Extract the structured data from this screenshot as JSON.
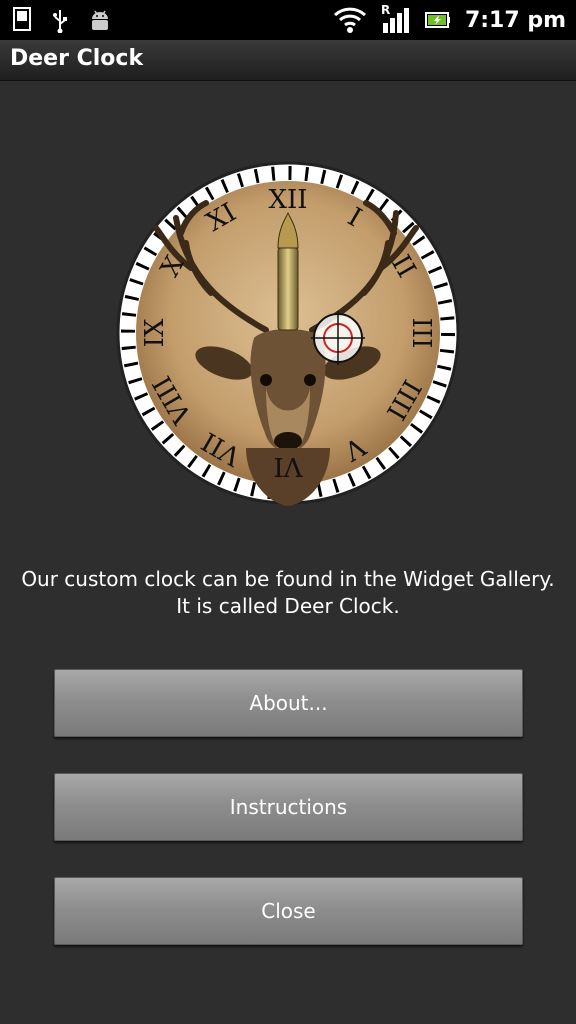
{
  "status_bar": {
    "time": "7:17 pm",
    "network_label": "R",
    "icons": [
      "sd-card-icon",
      "usb-icon",
      "android-debug-icon",
      "wifi-icon",
      "signal-icon",
      "battery-charging-icon"
    ]
  },
  "title_bar": {
    "title": "Deer Clock"
  },
  "clock": {
    "numerals": [
      "XII",
      "I",
      "II",
      "III",
      "IIII",
      "V",
      "VI",
      "VII",
      "VIII",
      "IX",
      "X",
      "XI"
    ]
  },
  "message": {
    "line1": "Our custom clock can be found in the Widget Gallery.",
    "line2": "It is called Deer Clock."
  },
  "buttons": {
    "about": "About...",
    "instructions": "Instructions",
    "close": "Close"
  },
  "colors": {
    "background": "#2e2e2e",
    "button": "#8e8e8e",
    "clock_face": "#c9a477"
  }
}
